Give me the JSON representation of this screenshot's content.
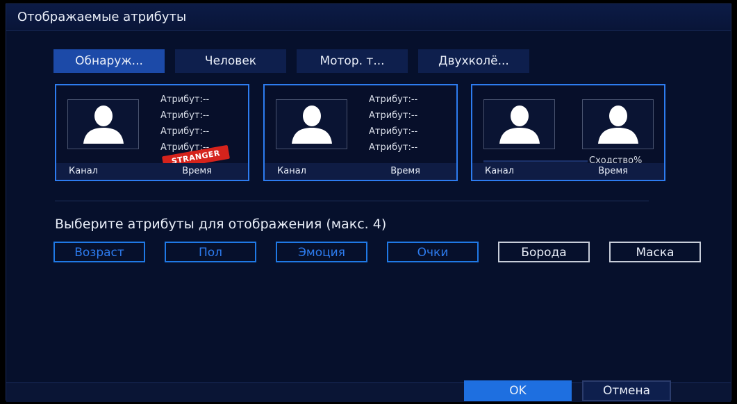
{
  "window": {
    "title": "Отображаемые атрибуты"
  },
  "tabs": [
    {
      "label": "Обнаруж...",
      "active": true
    },
    {
      "label": "Человек",
      "active": false
    },
    {
      "label": "Мотор. т...",
      "active": false
    },
    {
      "label": "Двухколё...",
      "active": false
    }
  ],
  "cards": [
    {
      "attributes": [
        "Атрибут:--",
        "Атрибут:--",
        "Атрибут:--",
        "Атрибут:--"
      ],
      "badge": "STRANGER",
      "channel": "Канал",
      "time": "Время"
    },
    {
      "attributes": [
        "Атрибут:--",
        "Атрибут:--",
        "Атрибут:--",
        "Атрибут:--"
      ],
      "channel": "Канал",
      "time": "Время"
    },
    {
      "similarity": "Сходство%",
      "channel": "Канал",
      "time": "Время"
    }
  ],
  "prompt": "Выберите атрибуты для отображения (макс. 4)",
  "attribute_options": [
    {
      "label": "Возраст",
      "selected": true
    },
    {
      "label": "Пол",
      "selected": true
    },
    {
      "label": "Эмоция",
      "selected": true
    },
    {
      "label": "Очки",
      "selected": true
    },
    {
      "label": "Борода",
      "selected": false
    },
    {
      "label": "Маска",
      "selected": false
    }
  ],
  "buttons": {
    "ok": "OK",
    "cancel": "Отмена"
  },
  "colors": {
    "accent": "#1e6fe0",
    "background": "#06102c",
    "badge": "#d5231c"
  }
}
